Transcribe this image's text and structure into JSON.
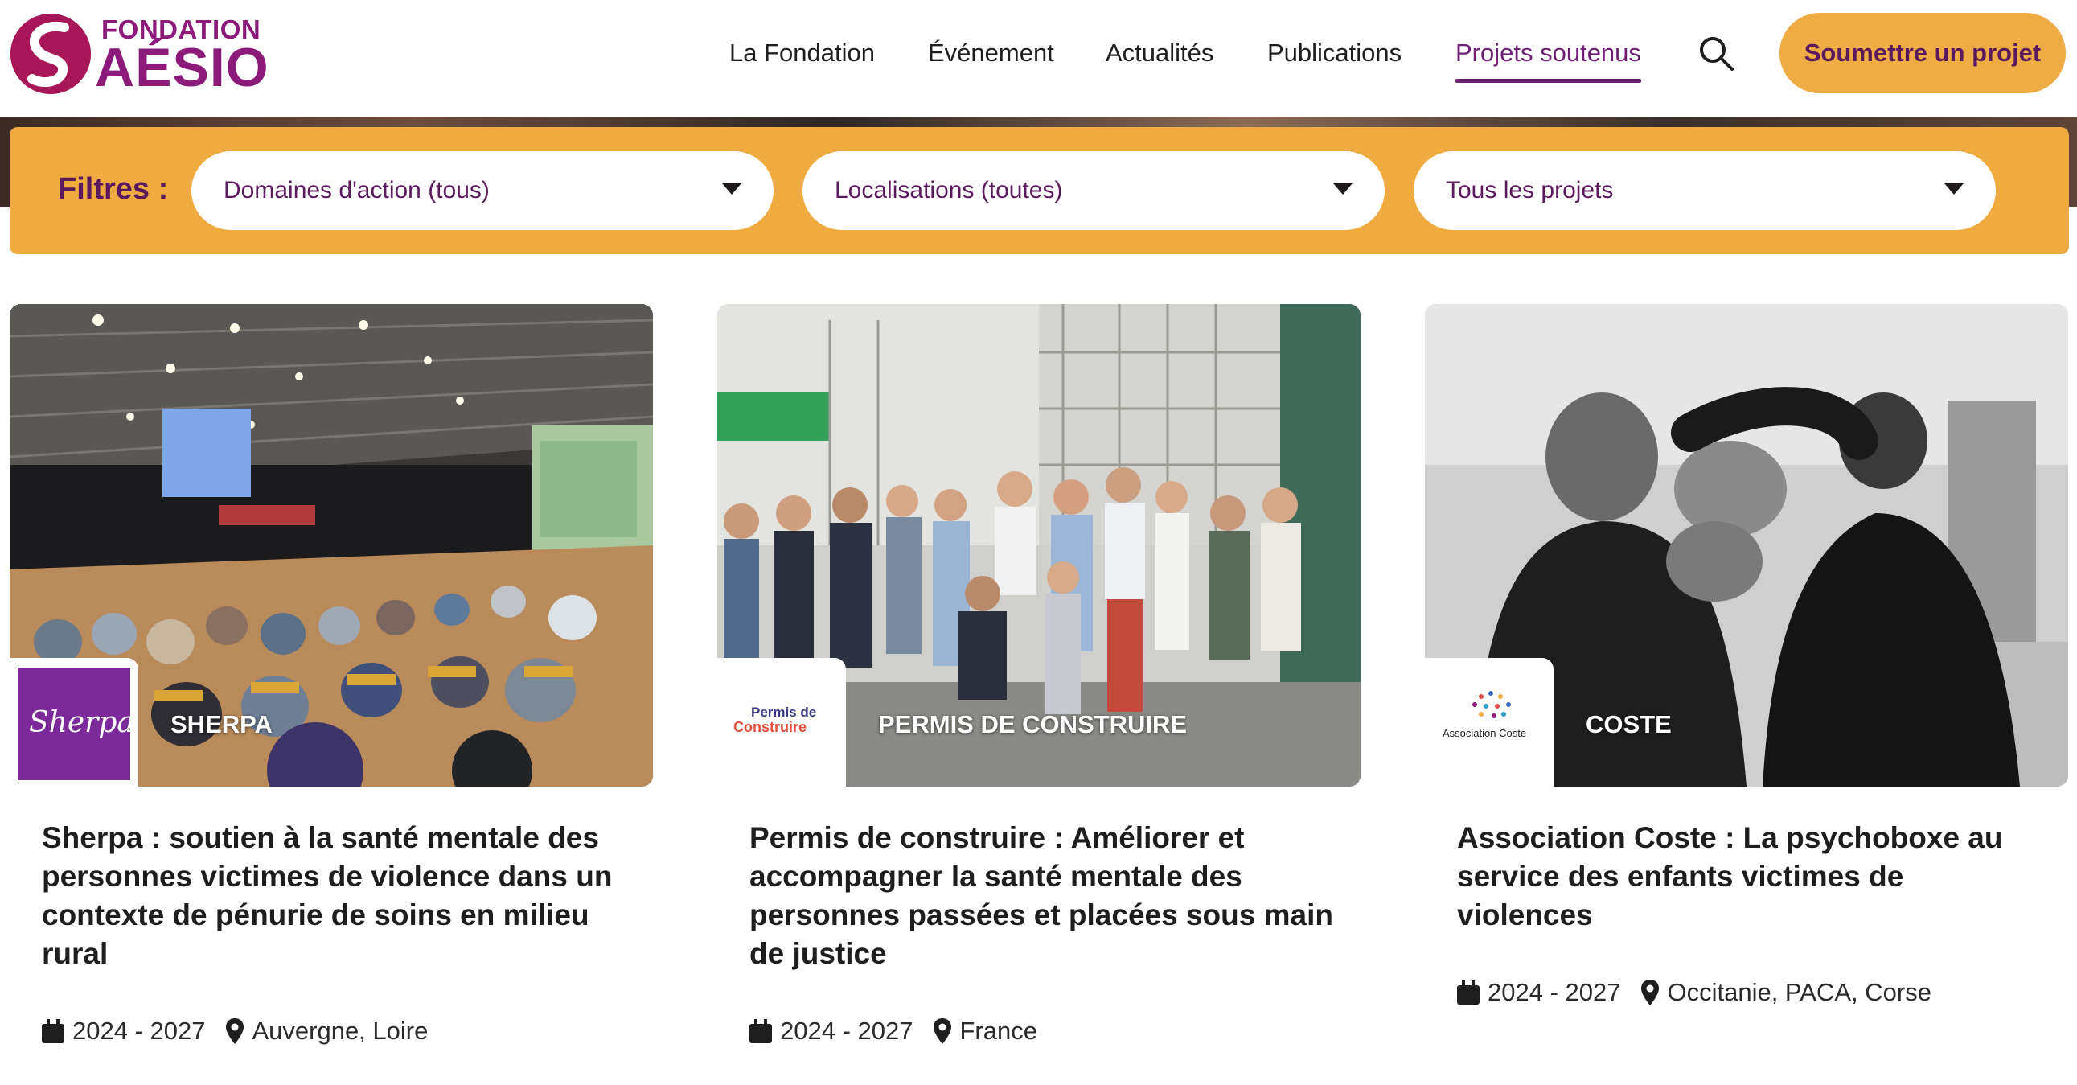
{
  "brand": {
    "top": "FONDATION",
    "main": "AÉSIO"
  },
  "nav": {
    "items": [
      {
        "label": "La Fondation"
      },
      {
        "label": "Événement"
      },
      {
        "label": "Actualités"
      },
      {
        "label": "Publications"
      },
      {
        "label": "Projets soutenus",
        "active": true
      }
    ],
    "search_icon": "search-icon",
    "cta_label": "Soumettre un projet"
  },
  "filters": {
    "label": "Filtres :",
    "domain": "Domaines d'action (tous)",
    "location": "Localisations (toutes)",
    "projects": "Tous les projets"
  },
  "cards": [
    {
      "name": "SHERPA",
      "logo_text": "Sherpa",
      "title": "Sherpa : soutien à la santé mentale des personnes victimes de violence dans un contexte de pénurie de soins en milieu rural",
      "years": "2024 - 2027",
      "location": "Auvergne, Loire"
    },
    {
      "name": "PERMIS DE CONSTRUIRE",
      "logo_text_1": "Permis de",
      "logo_text_2": "Construire",
      "title": "Permis de construire : Améliorer et accompagner la santé mentale des personnes passées et placées sous main de justice",
      "years": "2024 - 2027",
      "location": "France"
    },
    {
      "name": "COSTE",
      "logo_text": "Association Coste",
      "title": "Association Coste : La psychoboxe au service des enfants victimes de violences",
      "years": "2024 - 2027",
      "location": "Occitanie, PACA, Corse"
    }
  ],
  "colors": {
    "accent": "#f0ab40",
    "brand": "#8c1a7a",
    "text_brand": "#5b1a5e"
  }
}
